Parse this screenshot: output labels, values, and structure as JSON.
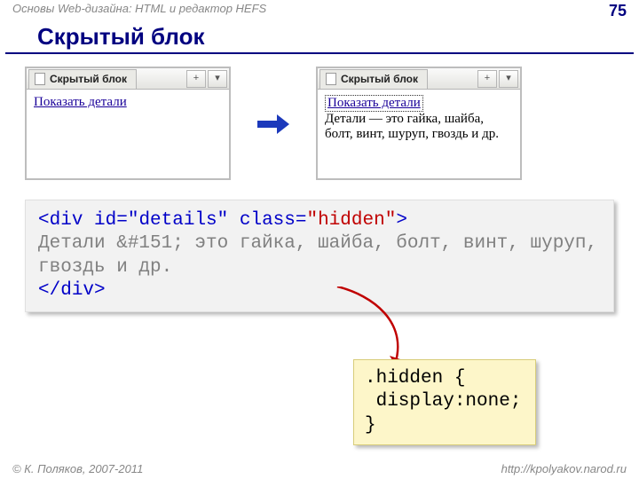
{
  "header": {
    "course": "Основы Web-дизайна: HTML и редактор HEFS",
    "page": "75"
  },
  "title": "Скрытый блок",
  "left_browser": {
    "tab": "Скрытый блок",
    "link": "Показать детали"
  },
  "right_browser": {
    "tab": "Скрытый блок",
    "link": "Показать детали",
    "details": "Детали — это гайка, шайба, болт, винт, шуруп, гвоздь и др."
  },
  "code": {
    "open_lt": "<",
    "div": "div",
    "id_attr": " id=",
    "id_val": "\"details\"",
    "class_attr": " class=",
    "class_val": "\"hidden\"",
    "open_gt": ">",
    "body": "Детали &#151; это гайка, шайба, болт, винт, шуруп, гвоздь и др.",
    "close": "</",
    "close_gt": ">"
  },
  "css": {
    "line1": ".hidden {",
    "line2": " display:none;",
    "line3": "}"
  },
  "footer": {
    "copyright": "© К. Поляков, 2007-2011",
    "url": "http://kpolyakov.narod.ru"
  }
}
